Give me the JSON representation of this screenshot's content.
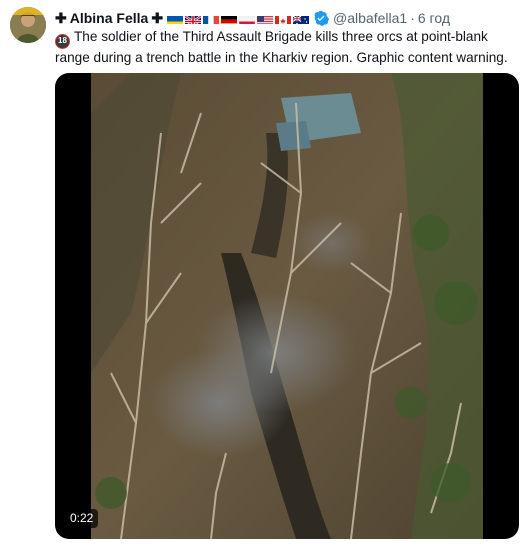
{
  "user": {
    "name": "Albina Fella",
    "cross_left": "✚",
    "cross_right": "✚",
    "handle": "@albafella1",
    "separator": "·",
    "timestamp": "6 год",
    "flags": [
      "ukraine-flag",
      "uk-flag",
      "france-flag",
      "germany-flag",
      "poland-flag",
      "usa-flag",
      "canada-flag",
      "australia-flag"
    ]
  },
  "tweet": {
    "age_badge": "18",
    "text": "The soldier of the Third Assault Brigade kills three orcs at point-blank range during a trench battle in the Kharkiv region. Graphic content warning."
  },
  "video": {
    "duration": "0:22"
  },
  "colors": {
    "text": "#0f1419",
    "secondary": "#536471",
    "verified": "#1d9bf0"
  }
}
